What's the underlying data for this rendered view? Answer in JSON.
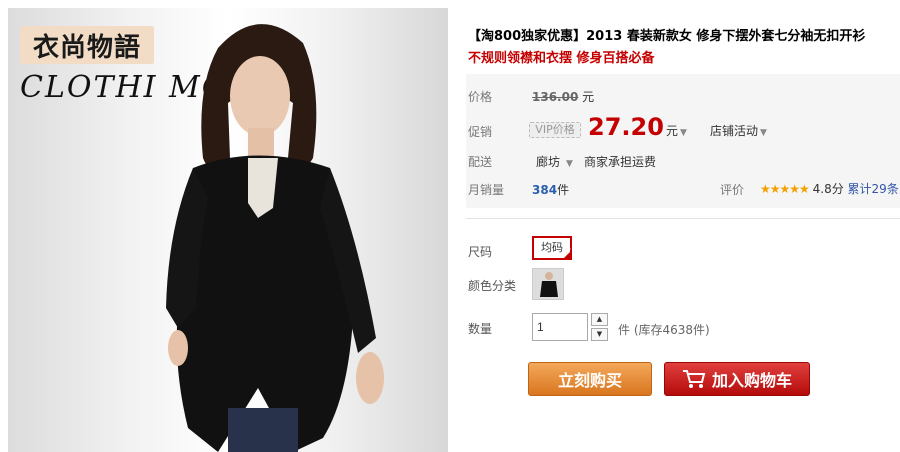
{
  "image": {
    "brand_cn": "衣尚物語",
    "brand_en": "CLOTHI  MOON"
  },
  "product": {
    "title_line1": "【淘800独家优惠】2013 春装新款女 修身下摆外套七分袖无扣开衫",
    "title_line2": "不规则领襟和衣摆 修身百搭必备"
  },
  "price": {
    "label": "价格",
    "original": "136.00",
    "unit": "元",
    "promo_label": "促销",
    "vip_badge": "VIP价格",
    "sale": "27.20",
    "sale_unit": "元",
    "activity": "店铺活动"
  },
  "delivery": {
    "label": "配送",
    "location": "廊坊",
    "note": "商家承担运费"
  },
  "sales": {
    "label": "月销量",
    "count": "384",
    "unit": "件",
    "rating_label": "评价",
    "stars": "★★★★★",
    "score": "4.8分",
    "total": "累计29条"
  },
  "options": {
    "size_label": "尺码",
    "size_value": "均码",
    "color_label": "颜色分类"
  },
  "quantity": {
    "label": "数量",
    "value": "1",
    "stock": "件 (库存4638件)"
  },
  "buttons": {
    "buy_now": "立刻购买",
    "add_to_cart": "加入购物车"
  },
  "colors": {
    "price_red": "#c40000",
    "buy_orange": "#e08a34",
    "cart_red": "#c41a1a",
    "star": "#f4a100"
  }
}
